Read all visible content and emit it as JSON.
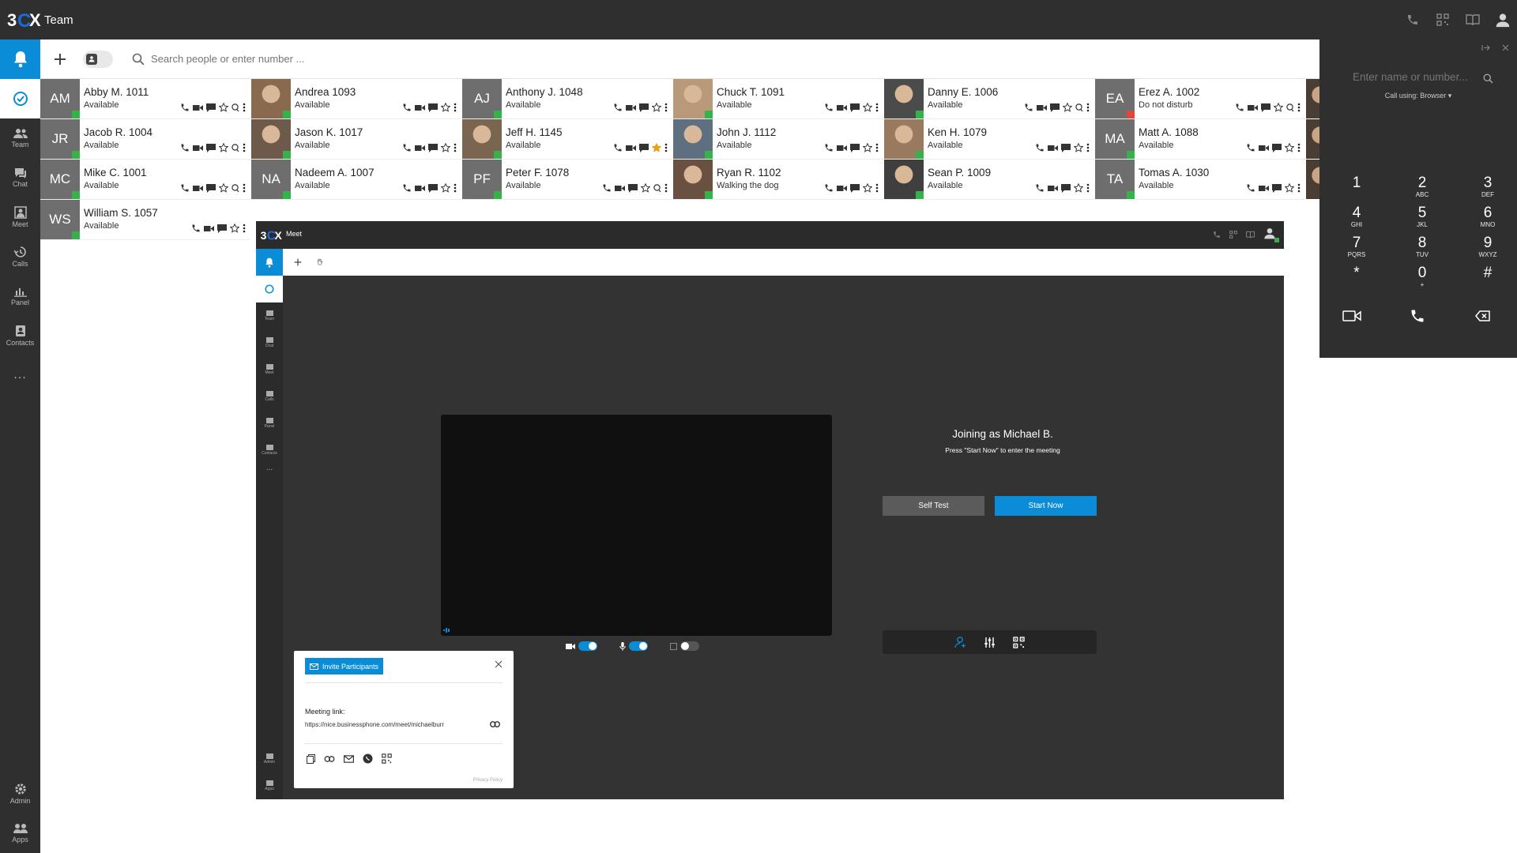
{
  "app": {
    "title": "Team"
  },
  "sidebar": {
    "items": [
      {
        "label": "Team"
      },
      {
        "label": "Chat"
      },
      {
        "label": "Meet"
      },
      {
        "label": "Calls"
      },
      {
        "label": "Panel"
      },
      {
        "label": "Contacts"
      }
    ],
    "more": "...",
    "bottom": [
      {
        "label": "Admin"
      },
      {
        "label": "Apps"
      }
    ]
  },
  "search": {
    "placeholder": "Search people or enter number ..."
  },
  "contacts": [
    {
      "initials": "AM",
      "name": "Abby M. 1011",
      "status": "Available"
    },
    {
      "initials": "",
      "name": "Andrea 1093",
      "status": "Available"
    },
    {
      "initials": "AJ",
      "name": "Anthony J. 1048",
      "status": "Available"
    },
    {
      "initials": "",
      "name": "Chuck T. 1091",
      "status": "Available"
    },
    {
      "initials": "",
      "name": "Danny E. 1006",
      "status": "Available"
    },
    {
      "initials": "EA",
      "name": "Erez A. 1002",
      "status": "Do not disturb"
    },
    {
      "initials": "JR",
      "name": "Jacob R. 1004",
      "status": "Available"
    },
    {
      "initials": "",
      "name": "Jason K. 1017",
      "status": "Available"
    },
    {
      "initials": "",
      "name": "Jeff H. 1145",
      "status": "Available"
    },
    {
      "initials": "",
      "name": "John J. 1112",
      "status": "Available"
    },
    {
      "initials": "",
      "name": "Ken H. 1079",
      "status": "Available"
    },
    {
      "initials": "MA",
      "name": "Matt A. 1088",
      "status": "Available"
    },
    {
      "initials": "MC",
      "name": "Mike C. 1001",
      "status": "Available"
    },
    {
      "initials": "NA",
      "name": "Nadeem A. 1007",
      "status": "Available"
    },
    {
      "initials": "PF",
      "name": "Peter F. 1078",
      "status": "Available"
    },
    {
      "initials": "",
      "name": "Ryan R. 1102",
      "status": "Walking the dog"
    },
    {
      "initials": "",
      "name": "Sean P. 1009",
      "status": "Available"
    },
    {
      "initials": "TA",
      "name": "Tomas A. 1030",
      "status": "Available"
    },
    {
      "initials": "WS",
      "name": "William S. 1057",
      "status": "Available"
    }
  ],
  "meet": {
    "title": "Meet",
    "sidebar": [
      "Team",
      "Chat",
      "Meet",
      "Calls",
      "Panel",
      "Contacts"
    ],
    "sidebar_bottom": [
      "Admin",
      "Apps"
    ],
    "more": "...",
    "joining": "Joining as Michael B.",
    "hint": "Press \"Start Now\" to enter the meeting",
    "self_test": "Self Test",
    "start_now": "Start Now",
    "invite": {
      "button": "Invite Participants",
      "label": "Meeting link:",
      "link": "https://nice.businessphone.com/meet/michaelburr",
      "privacy": "Privacy Policy"
    }
  },
  "dialer": {
    "placeholder": "Enter name or number...",
    "call_using": "Call using: Browser ▾",
    "keys": [
      {
        "digit": "1",
        "letters": ""
      },
      {
        "digit": "2",
        "letters": "ABC"
      },
      {
        "digit": "3",
        "letters": "DEF"
      },
      {
        "digit": "4",
        "letters": "GHI"
      },
      {
        "digit": "5",
        "letters": "JKL"
      },
      {
        "digit": "6",
        "letters": "MNO"
      },
      {
        "digit": "7",
        "letters": "PQRS"
      },
      {
        "digit": "8",
        "letters": "TUV"
      },
      {
        "digit": "9",
        "letters": "WXYZ"
      },
      {
        "digit": "*",
        "letters": ""
      },
      {
        "digit": "0",
        "letters": "+"
      },
      {
        "digit": "#",
        "letters": ""
      }
    ]
  },
  "colors": {
    "accent": "#0a8cd6",
    "available": "#36b24a",
    "dnd": "#e0463a",
    "dark": "#2f2f2f",
    "star_active": "#e8a21a"
  }
}
